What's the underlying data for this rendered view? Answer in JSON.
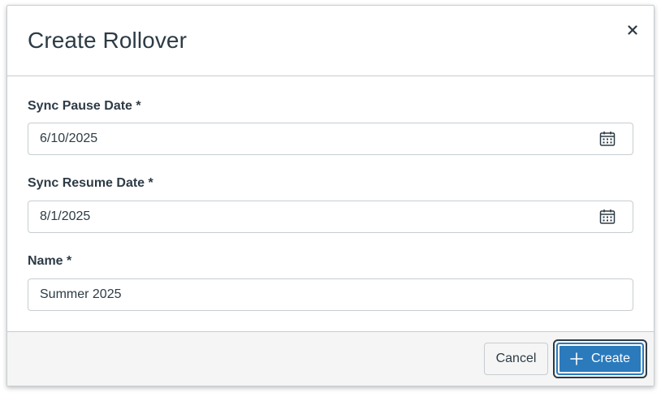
{
  "dialog": {
    "title": "Create Rollover",
    "close_icon": "close-icon"
  },
  "fields": {
    "pause": {
      "label": "Sync Pause Date *",
      "value": "6/10/2025",
      "icon": "calendar-icon"
    },
    "resume": {
      "label": "Sync Resume Date *",
      "value": "8/1/2025",
      "icon": "calendar-icon"
    },
    "name": {
      "label": "Name *",
      "value": "Summer 2025"
    }
  },
  "footer": {
    "cancel_label": "Cancel",
    "create_label": "Create",
    "create_icon": "plus-icon"
  },
  "colors": {
    "primary": "#2b7abc",
    "text": "#2d3b45",
    "border": "#c7cdd1",
    "footer_bg": "#f5f5f5",
    "highlight": "#8b1a1a"
  }
}
